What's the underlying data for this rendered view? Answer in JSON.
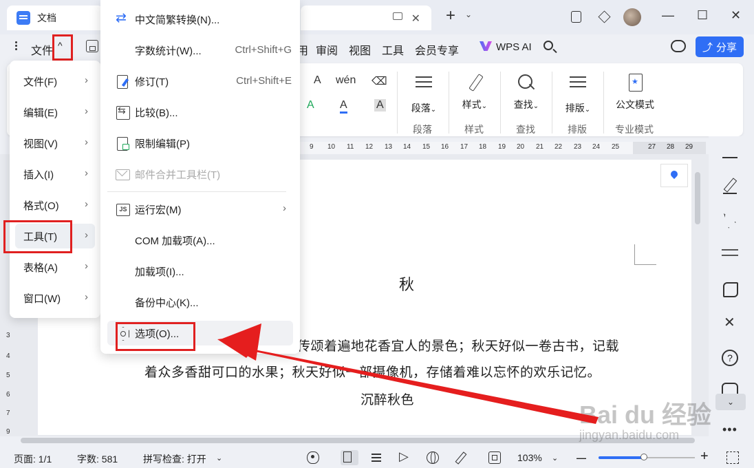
{
  "titlebar": {
    "doc_tab_label": "文档",
    "new_tab_plus": "+",
    "new_tab_chevron": "⌄",
    "window_controls": {
      "minimize": "—",
      "maximize": "☐",
      "close": "✕"
    }
  },
  "menubar": {
    "file_label": "文件",
    "tabs": [
      "用",
      "审阅",
      "视图",
      "工具",
      "会员专享"
    ],
    "wps_ai_label": "WPS AI",
    "share_label": "分享"
  },
  "ribbon": {
    "groups": [
      {
        "button": "段落",
        "group_label": "段落"
      },
      {
        "button": "样式",
        "group_label": "样式"
      },
      {
        "button": "查找",
        "group_label": "查找"
      },
      {
        "button": "排版",
        "group_label": "排版"
      },
      {
        "button": "公文模式",
        "group_label": "专业模式"
      }
    ],
    "font_tools": {
      "font_a": "A",
      "font_a_sub": "A",
      "pinyin": "wén",
      "eraser": "⌫",
      "highlight": "A",
      "color_a": "A",
      "shade_a": "A"
    }
  },
  "ruler": {
    "ticks": [
      "9",
      "10",
      "11",
      "12",
      "13",
      "14",
      "15",
      "16",
      "17",
      "18",
      "19",
      "20",
      "21",
      "22",
      "23",
      "24",
      "25",
      "",
      "27",
      "28",
      "29"
    ]
  },
  "left_ruler": {
    "ticks": [
      "3",
      "4",
      "5",
      "6",
      "7",
      "8",
      "9"
    ]
  },
  "document": {
    "title": "秋",
    "line1": "传颂着遍地花香宜人的景色；秋天好似一卷古书，记载",
    "line2": "着众多香甜可口的水果；秋天好似一部摄像机，存储着难以忘怀的欢乐记忆。",
    "line3": "沉醉秋色"
  },
  "menu_main": {
    "items": [
      {
        "label": "文件(F)"
      },
      {
        "label": "编辑(E)"
      },
      {
        "label": "视图(V)"
      },
      {
        "label": "插入(I)"
      },
      {
        "label": "格式(O)"
      },
      {
        "label": "工具(T)"
      },
      {
        "label": "表格(A)"
      },
      {
        "label": "窗口(W)"
      }
    ],
    "chevron": "›"
  },
  "menu_tools": {
    "items": [
      {
        "label": "中文简繁转换(N)...",
        "shortcut": ""
      },
      {
        "label": "字数统计(W)...",
        "shortcut": "Ctrl+Shift+G"
      },
      {
        "label": "修订(T)",
        "shortcut": "Ctrl+Shift+E"
      },
      {
        "label": "比较(B)...",
        "shortcut": ""
      },
      {
        "label": "限制编辑(P)",
        "shortcut": ""
      },
      {
        "label": "邮件合并工具栏(T)",
        "shortcut": ""
      },
      {
        "label": "运行宏(M)",
        "shortcut": ""
      },
      {
        "label": "COM 加载项(A)...",
        "shortcut": ""
      },
      {
        "label": "加载项(I)...",
        "shortcut": ""
      },
      {
        "label": "备份中心(K)...",
        "shortcut": ""
      },
      {
        "label": "选项(O)...",
        "shortcut": ""
      }
    ]
  },
  "statusbar": {
    "page": "页面: 1/1",
    "words": "字数: 581",
    "spellcheck": "拼写检查: 打开",
    "spellcheck_chevron": "⌄",
    "zoom": "103%",
    "zoom_chevron": "⌄",
    "zoom_minus": "—",
    "zoom_plus": "+",
    "zoom_level": 0.47
  },
  "sidebar": {
    "help": "?",
    "collapse": "⌄",
    "more": "•••"
  },
  "watermark": {
    "brand": "Bai du 经验",
    "url": "jingyan.baidu.com"
  },
  "colors": {
    "accent": "#2f6ef5",
    "annotation_red": "#e02020"
  }
}
